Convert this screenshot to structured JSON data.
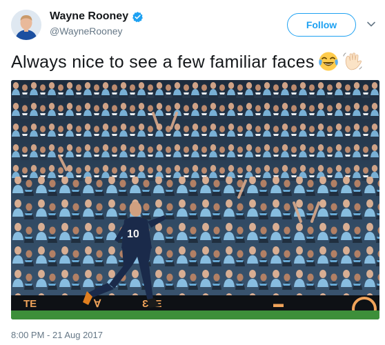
{
  "author": {
    "name": "Wayne Rooney",
    "handle": "@WayneRooney",
    "verified": true,
    "avatar_icon": "profile-avatar-icon"
  },
  "follow": {
    "label": "Follow"
  },
  "menu": {
    "icon": "chevron-down-icon"
  },
  "tweet": {
    "text": "Always nice to see a few familiar faces",
    "emojis": [
      "face-with-tears-of-joy",
      "waving-hand"
    ]
  },
  "media": {
    "description_icon": "crowd-photo",
    "player_number": "10"
  },
  "meta": {
    "timestamp": "8:00 PM - 21 Aug 2017"
  },
  "colors": {
    "accent": "#1da1f2",
    "text": "#14171a",
    "muted": "#657786"
  }
}
